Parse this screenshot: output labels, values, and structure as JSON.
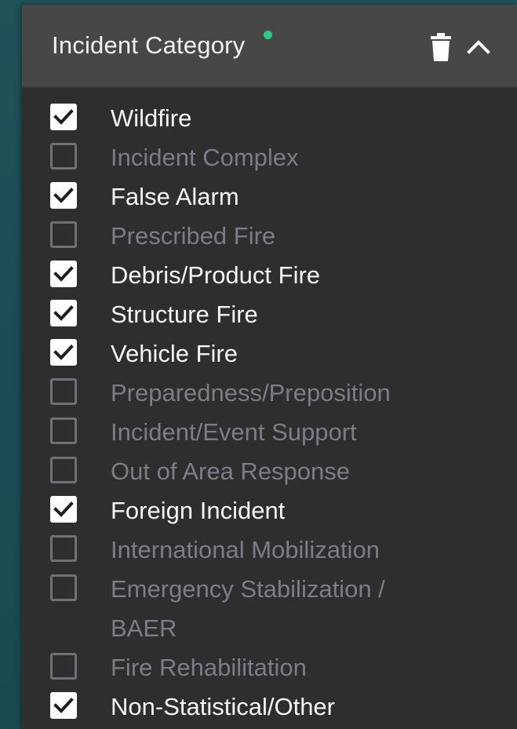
{
  "panel": {
    "title": "Incident Category",
    "active_dot_color": "#2fc98b",
    "delete_icon": "trash-icon",
    "collapse_icon": "chevron-up-icon"
  },
  "categories": [
    {
      "label": "Wildfire",
      "checked": true
    },
    {
      "label": "Incident Complex",
      "checked": false
    },
    {
      "label": "False Alarm",
      "checked": true
    },
    {
      "label": "Prescribed Fire",
      "checked": false
    },
    {
      "label": "Debris/Product Fire",
      "checked": true
    },
    {
      "label": "Structure Fire",
      "checked": true
    },
    {
      "label": "Vehicle Fire",
      "checked": true
    },
    {
      "label": "Preparedness/Preposition",
      "checked": false
    },
    {
      "label": "Incident/Event Support",
      "checked": false
    },
    {
      "label": "Out of Area Response",
      "checked": false
    },
    {
      "label": "Foreign Incident",
      "checked": true
    },
    {
      "label": "International Mobilization",
      "checked": false
    },
    {
      "label": "Emergency Stabilization / BAER",
      "checked": false
    },
    {
      "label": "Fire Rehabilitation",
      "checked": false
    },
    {
      "label": "Non-Statistical/Other",
      "checked": true
    }
  ]
}
